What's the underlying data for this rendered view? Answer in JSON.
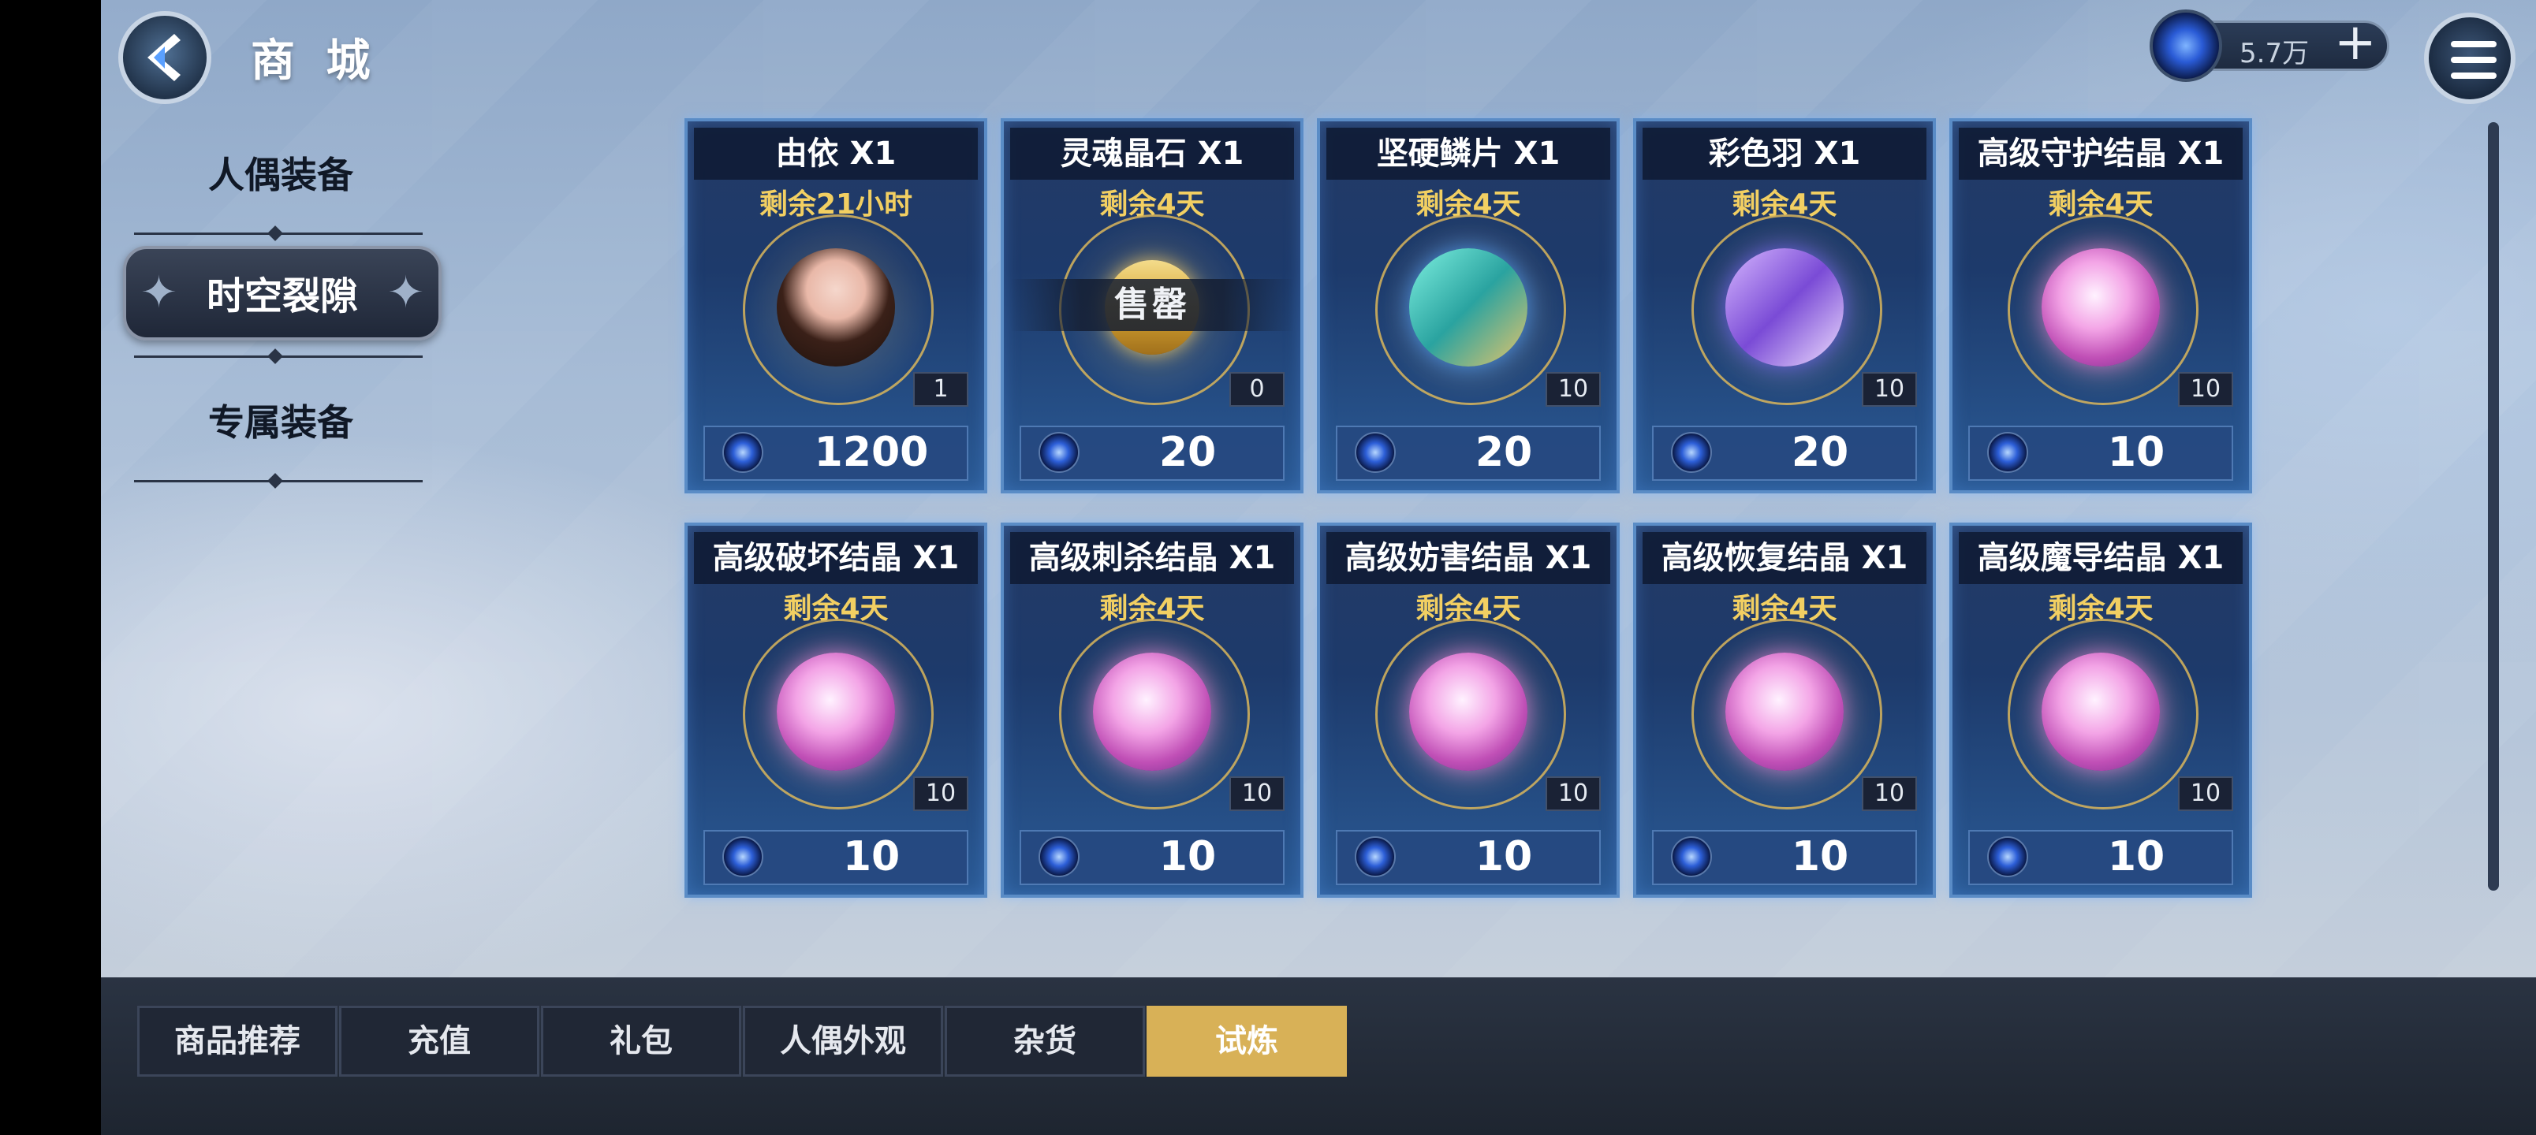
{
  "header": {
    "title": "商 城",
    "currency_value": "5.7万",
    "currency_plus": "+"
  },
  "nav": {
    "items": [
      {
        "label": "人偶装备",
        "active": false
      },
      {
        "label": "时空裂隙",
        "active": true
      },
      {
        "label": "专属装备",
        "active": false
      }
    ]
  },
  "shop": {
    "sold_out_label": "售罄",
    "items": [
      {
        "name": "由依 X1",
        "time_left": "剩余21小时",
        "count": "1",
        "price": "1200",
        "art": "portrait"
      },
      {
        "name": "灵魂晶石 X1",
        "time_left": "剩余4天",
        "count": "0",
        "price": "20",
        "art": "soul-gem",
        "sold_out": true
      },
      {
        "name": "坚硬鳞片 X1",
        "time_left": "剩余4天",
        "count": "10",
        "price": "20",
        "art": "feather-teal"
      },
      {
        "name": "彩色羽 X1",
        "time_left": "剩余4天",
        "count": "10",
        "price": "20",
        "art": "feather-purple"
      },
      {
        "name": "高级守护结晶 X1",
        "time_left": "剩余4天",
        "count": "10",
        "price": "10",
        "art": "crystal"
      },
      {
        "name": "高级破坏结晶 X1",
        "time_left": "剩余4天",
        "count": "10",
        "price": "10",
        "art": "crystal"
      },
      {
        "name": "高级刺杀结晶 X1",
        "time_left": "剩余4天",
        "count": "10",
        "price": "10",
        "art": "crystal"
      },
      {
        "name": "高级妨害结晶 X1",
        "time_left": "剩余4天",
        "count": "10",
        "price": "10",
        "art": "crystal"
      },
      {
        "name": "高级恢复结晶 X1",
        "time_left": "剩余4天",
        "count": "10",
        "price": "10",
        "art": "crystal"
      },
      {
        "name": "高级魔导结晶 X1",
        "time_left": "剩余4天",
        "count": "10",
        "price": "10",
        "art": "crystal"
      }
    ]
  },
  "tabs": [
    {
      "label": "商品推荐",
      "active": false
    },
    {
      "label": "充值",
      "active": false
    },
    {
      "label": "礼包",
      "active": false
    },
    {
      "label": "人偶外观",
      "active": false
    },
    {
      "label": "杂货",
      "active": false
    },
    {
      "label": "试炼",
      "active": true
    }
  ],
  "colors": {
    "accent_gold": "#d8b157",
    "time_left_text": "#f2cf62",
    "card_border": "#5a8cc6"
  }
}
